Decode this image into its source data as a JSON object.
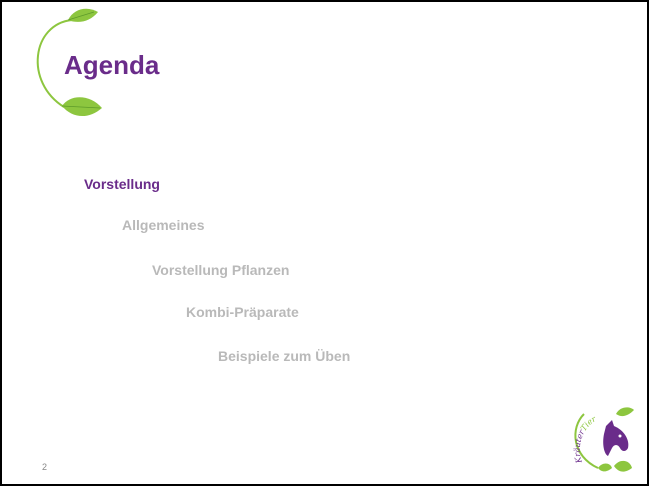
{
  "slide": {
    "title": "Agenda",
    "page_number": "2",
    "accent_color": "#6a2c8a",
    "inactive_color": "#b9b9b9",
    "leaf_color": "#8dc63f"
  },
  "agenda": {
    "items": [
      {
        "label": "Vorstellung",
        "active": true
      },
      {
        "label": "Allgemeines",
        "active": false
      },
      {
        "label": "Vorstellung Pflanzen",
        "active": false
      },
      {
        "label": "Kombi-Präparate",
        "active": false
      },
      {
        "label": "Beispiele zum Üben",
        "active": false
      }
    ]
  },
  "logo": {
    "text_a": "Kräuter",
    "text_b": "Tierchen",
    "icon": "horse-head-leaf-logo"
  }
}
